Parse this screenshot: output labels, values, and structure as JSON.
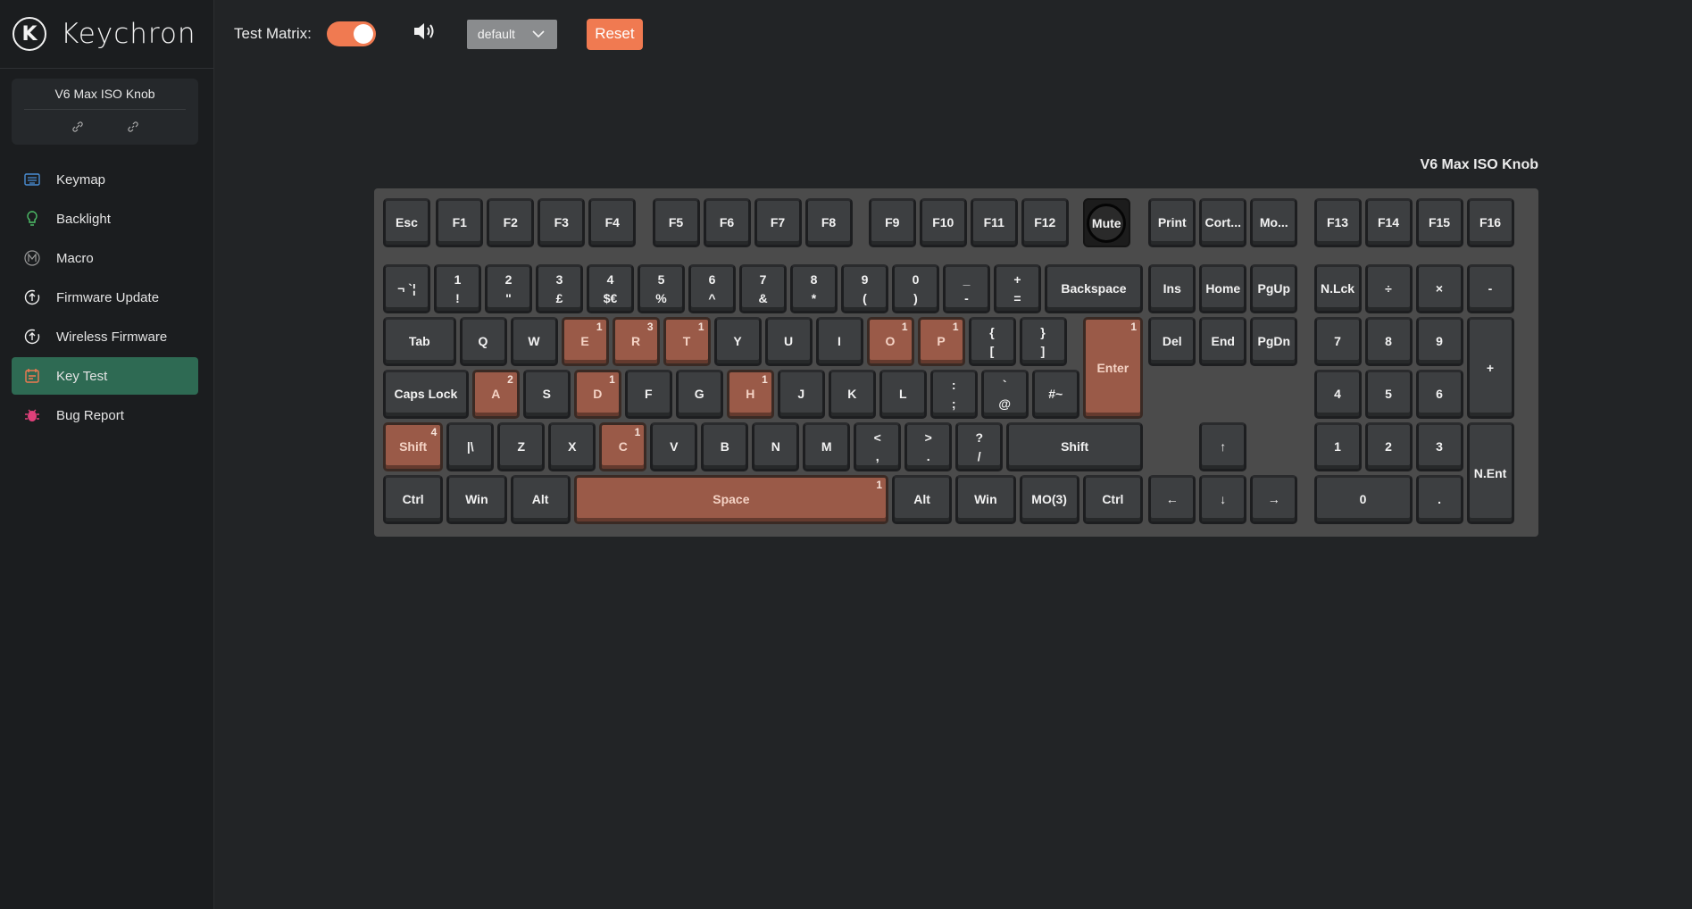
{
  "app": {
    "brand": "Keychron"
  },
  "device": {
    "name": "V6 Max ISO Knob",
    "icons": [
      "link-icon",
      "unlink-icon"
    ]
  },
  "nav": [
    {
      "label": "Keymap",
      "icon": "keyboard-icon",
      "color": "#4a8fd6",
      "active": false
    },
    {
      "label": "Backlight",
      "icon": "bulb-icon",
      "color": "#4fc36a",
      "active": false
    },
    {
      "label": "Macro",
      "icon": "macro-icon",
      "color": "#9a9a9a",
      "active": false
    },
    {
      "label": "Firmware Update",
      "icon": "firmware-icon",
      "color": "#f0f0f0",
      "active": false
    },
    {
      "label": "Wireless Firmware",
      "icon": "wireless-firmware-icon",
      "color": "#f0f0f0",
      "active": false
    },
    {
      "label": "Key Test",
      "icon": "key-test-icon",
      "color": "#f07a51",
      "active": true
    },
    {
      "label": "Bug Report",
      "icon": "bug-icon",
      "color": "#e0407a",
      "active": false
    }
  ],
  "toolbar": {
    "test_matrix_label": "Test Matrix:",
    "test_matrix_on": true,
    "sound_icon": "speaker-icon",
    "layout_select": "default",
    "reset_label": "Reset"
  },
  "keyboard": {
    "title": "V6 Max ISO Knob",
    "colors": {
      "frame": "#4b4b4b",
      "key": "#3d3f41",
      "pressed_key": "#9a5a48",
      "accent": "#f07a51"
    },
    "keys": [
      {
        "id": "esc",
        "label": "Esc"
      },
      {
        "id": "f1",
        "label": "F1"
      },
      {
        "id": "f2",
        "label": "F2"
      },
      {
        "id": "f3",
        "label": "F3"
      },
      {
        "id": "f4",
        "label": "F4"
      },
      {
        "id": "f5",
        "label": "F5"
      },
      {
        "id": "f6",
        "label": "F6"
      },
      {
        "id": "f7",
        "label": "F7"
      },
      {
        "id": "f8",
        "label": "F8"
      },
      {
        "id": "f9",
        "label": "F9"
      },
      {
        "id": "f10",
        "label": "F10"
      },
      {
        "id": "f11",
        "label": "F11"
      },
      {
        "id": "f12",
        "label": "F12"
      },
      {
        "id": "mute",
        "label": "Mute",
        "knob": true
      },
      {
        "id": "print",
        "label": "Print"
      },
      {
        "id": "cort",
        "label": "Cort..."
      },
      {
        "id": "mo",
        "label": "Mo..."
      },
      {
        "id": "f13",
        "label": "F13"
      },
      {
        "id": "f14",
        "label": "F14"
      },
      {
        "id": "f15",
        "label": "F15"
      },
      {
        "id": "f16",
        "label": "F16"
      },
      {
        "id": "grave",
        "label": "¬ `¦"
      },
      {
        "id": "1",
        "label": "1\n!"
      },
      {
        "id": "2",
        "label": "2\n\""
      },
      {
        "id": "3",
        "label": "3\n£"
      },
      {
        "id": "4",
        "label": "4\n$€"
      },
      {
        "id": "5",
        "label": "5\n%"
      },
      {
        "id": "6",
        "label": "6\n^"
      },
      {
        "id": "7",
        "label": "7\n&"
      },
      {
        "id": "8",
        "label": "8\n*"
      },
      {
        "id": "9",
        "label": "9\n("
      },
      {
        "id": "0",
        "label": "0\n)"
      },
      {
        "id": "minus",
        "label": "_\n-"
      },
      {
        "id": "equal",
        "label": "+\n="
      },
      {
        "id": "backspace",
        "label": "Backspace"
      },
      {
        "id": "ins",
        "label": "Ins"
      },
      {
        "id": "home",
        "label": "Home"
      },
      {
        "id": "pgup",
        "label": "PgUp"
      },
      {
        "id": "nlck",
        "label": "N.Lck"
      },
      {
        "id": "ndiv",
        "label": "÷"
      },
      {
        "id": "nmul",
        "label": "×"
      },
      {
        "id": "nsub",
        "label": "-"
      },
      {
        "id": "tab",
        "label": "Tab"
      },
      {
        "id": "q",
        "label": "Q"
      },
      {
        "id": "w",
        "label": "W"
      },
      {
        "id": "e",
        "label": "E",
        "count": 1
      },
      {
        "id": "r",
        "label": "R",
        "count": 3
      },
      {
        "id": "t",
        "label": "T",
        "count": 1
      },
      {
        "id": "y",
        "label": "Y"
      },
      {
        "id": "u",
        "label": "U"
      },
      {
        "id": "i",
        "label": "I"
      },
      {
        "id": "o",
        "label": "O",
        "count": 1
      },
      {
        "id": "p",
        "label": "P",
        "count": 1
      },
      {
        "id": "lbr",
        "label": "{\n["
      },
      {
        "id": "rbr",
        "label": "}\n]"
      },
      {
        "id": "enter",
        "label": "Enter",
        "count": 1
      },
      {
        "id": "del",
        "label": "Del"
      },
      {
        "id": "end",
        "label": "End"
      },
      {
        "id": "pgdn",
        "label": "PgDn"
      },
      {
        "id": "n7",
        "label": "7"
      },
      {
        "id": "n8",
        "label": "8"
      },
      {
        "id": "n9",
        "label": "9"
      },
      {
        "id": "nadd",
        "label": "+"
      },
      {
        "id": "caps",
        "label": "Caps Lock"
      },
      {
        "id": "a",
        "label": "A",
        "count": 2
      },
      {
        "id": "s",
        "label": "S"
      },
      {
        "id": "d",
        "label": "D",
        "count": 1
      },
      {
        "id": "f",
        "label": "F"
      },
      {
        "id": "g",
        "label": "G"
      },
      {
        "id": "h",
        "label": "H",
        "count": 1
      },
      {
        "id": "j",
        "label": "J"
      },
      {
        "id": "k",
        "label": "K"
      },
      {
        "id": "l",
        "label": "L"
      },
      {
        "id": "semi",
        "label": ":\n;"
      },
      {
        "id": "quote",
        "label": "`\n@"
      },
      {
        "id": "hash",
        "label": "#~"
      },
      {
        "id": "n4",
        "label": "4"
      },
      {
        "id": "n5",
        "label": "5"
      },
      {
        "id": "n6",
        "label": "6"
      },
      {
        "id": "lshift",
        "label": "Shift",
        "count": 4
      },
      {
        "id": "iso",
        "label": "|\\"
      },
      {
        "id": "z",
        "label": "Z"
      },
      {
        "id": "x",
        "label": "X"
      },
      {
        "id": "c",
        "label": "C",
        "count": 1
      },
      {
        "id": "v",
        "label": "V"
      },
      {
        "id": "b",
        "label": "B"
      },
      {
        "id": "n",
        "label": "N"
      },
      {
        "id": "m",
        "label": "M"
      },
      {
        "id": "comma",
        "label": "<\n,"
      },
      {
        "id": "period",
        "label": ">\n."
      },
      {
        "id": "slash",
        "label": "?\n/"
      },
      {
        "id": "rshift",
        "label": "Shift"
      },
      {
        "id": "up",
        "label": "↑"
      },
      {
        "id": "n1",
        "label": "1"
      },
      {
        "id": "n2",
        "label": "2"
      },
      {
        "id": "n3",
        "label": "3"
      },
      {
        "id": "nent",
        "label": "N.Ent"
      },
      {
        "id": "lctrl",
        "label": "Ctrl"
      },
      {
        "id": "lwin",
        "label": "Win"
      },
      {
        "id": "lalt",
        "label": "Alt"
      },
      {
        "id": "space",
        "label": "Space",
        "count": 1
      },
      {
        "id": "ralt",
        "label": "Alt"
      },
      {
        "id": "rwin",
        "label": "Win"
      },
      {
        "id": "mo3",
        "label": "MO(3)"
      },
      {
        "id": "rctrl",
        "label": "Ctrl"
      },
      {
        "id": "left",
        "label": "←"
      },
      {
        "id": "down",
        "label": "↓"
      },
      {
        "id": "right",
        "label": "→"
      },
      {
        "id": "n0",
        "label": "0"
      },
      {
        "id": "ndot",
        "label": "."
      }
    ]
  }
}
